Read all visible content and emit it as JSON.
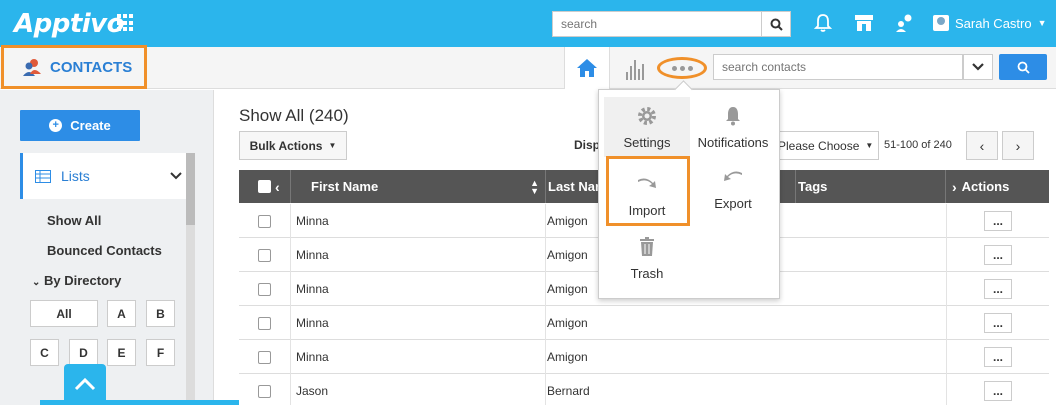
{
  "app": {
    "logo": "Apptivo"
  },
  "topbar": {
    "search_placeholder": "search",
    "user_name": "Sarah Castro"
  },
  "module": {
    "title": "CONTACTS"
  },
  "subbar": {
    "contact_search_placeholder": "search contacts"
  },
  "sidebar": {
    "create_label": "Create",
    "lists_label": "Lists",
    "links": [
      "Show All",
      "Bounced Contacts"
    ],
    "directory_label": "By Directory",
    "letters": [
      "All",
      "A",
      "B",
      "C",
      "D",
      "E",
      "F"
    ]
  },
  "main": {
    "title": "Show All (240)",
    "bulk_label": "Bulk Actions",
    "display_label": "Disp",
    "please_choose": "Please Choose",
    "paging": "51-100 of 240",
    "columns": {
      "first_name": "First Name",
      "last_name": "Last Nar",
      "tags": "Tags",
      "actions": "Actions"
    },
    "rows": [
      {
        "first": "Minna",
        "last": "Amigon"
      },
      {
        "first": "Minna",
        "last": "Amigon"
      },
      {
        "first": "Minna",
        "last": "Amigon"
      },
      {
        "first": "Minna",
        "last": "Amigon"
      },
      {
        "first": "Minna",
        "last": "Amigon"
      },
      {
        "first": "Jason",
        "last": "Bernard"
      }
    ],
    "row_action": "..."
  },
  "dropdown": {
    "settings": "Settings",
    "notifications": "Notifications",
    "import": "Import",
    "export": "Export",
    "trash": "Trash"
  },
  "colors": {
    "brand": "#2bb5ec",
    "accent": "#2d8de6",
    "highlight": "#f0902a"
  }
}
